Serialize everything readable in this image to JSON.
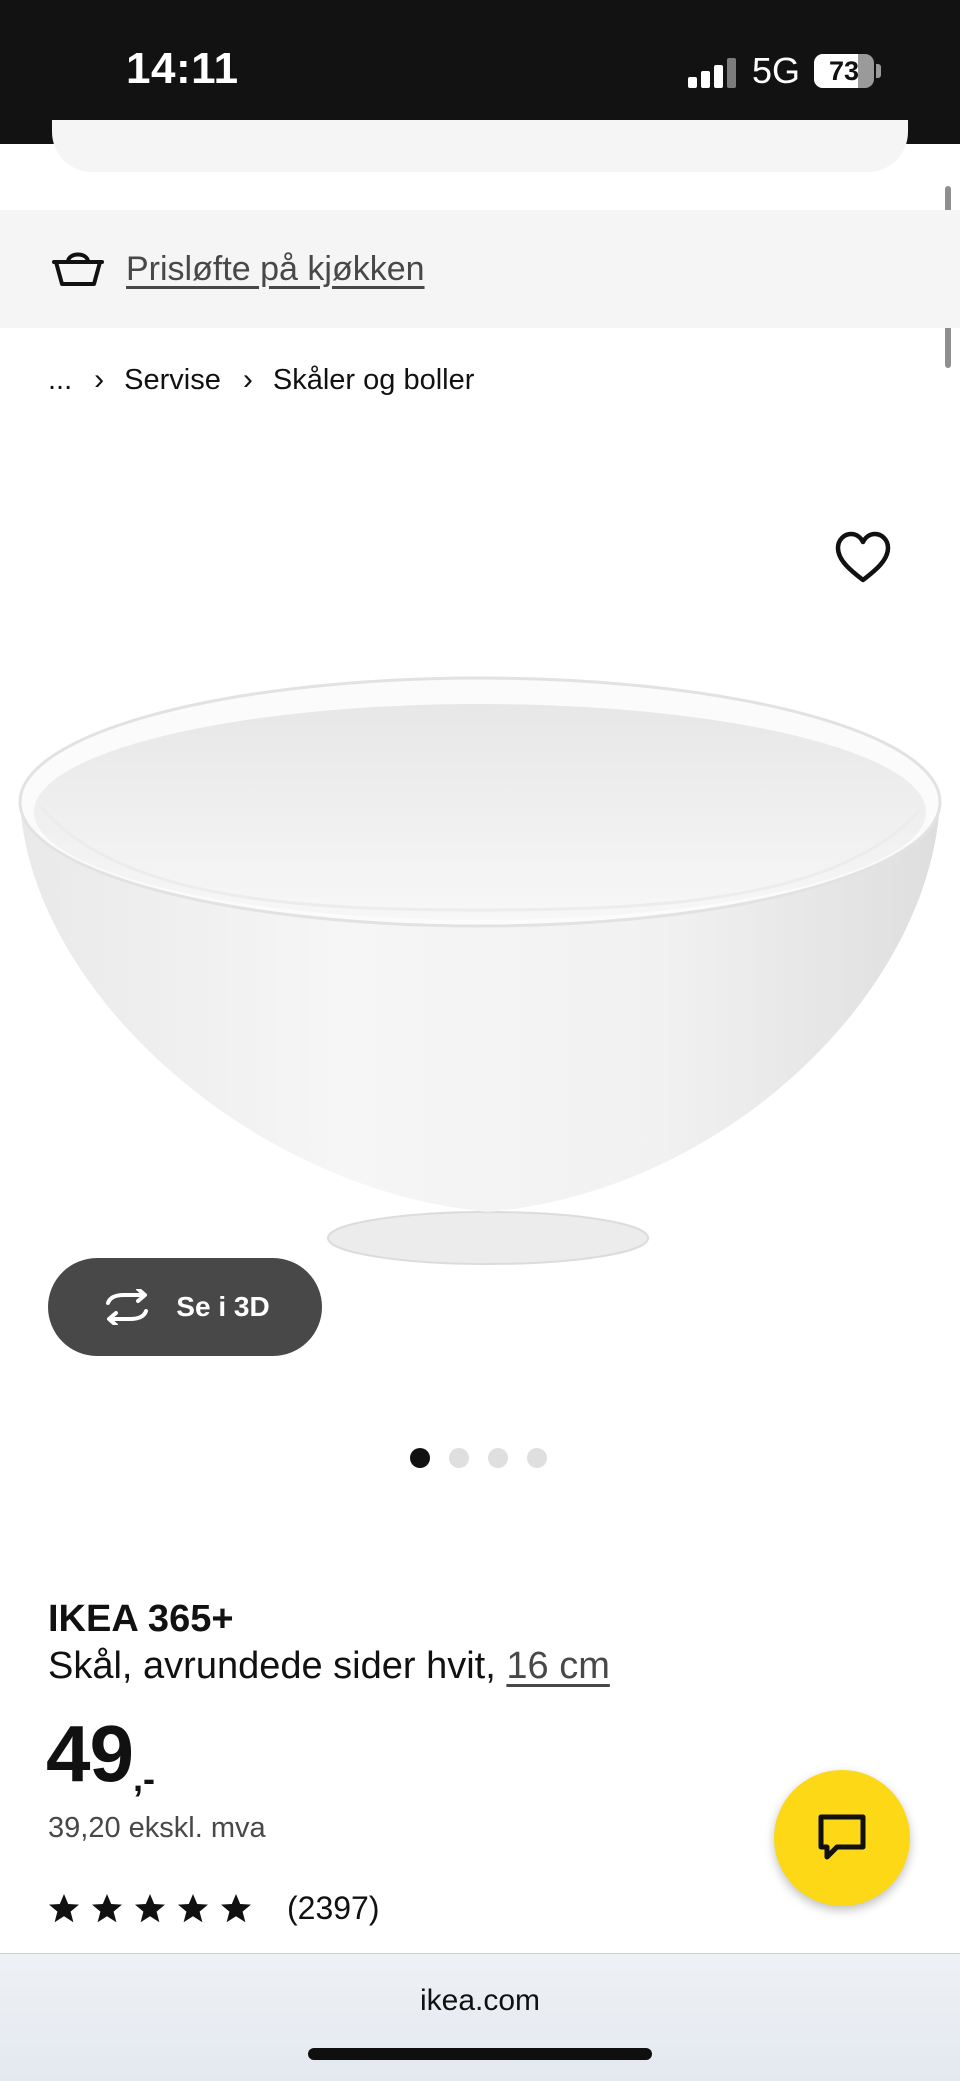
{
  "status_bar": {
    "time": "14:11",
    "network": "5G",
    "battery": "73",
    "battery_level_percent": 73
  },
  "promo": {
    "label": "Prisløfte på kjøkken",
    "icon": "basket-icon"
  },
  "breadcrumb": {
    "ellipsis": "...",
    "items": [
      "Servise",
      "Skåler og boller"
    ]
  },
  "gallery": {
    "view_3d_label": "Se i 3D",
    "total_images": 4,
    "active_index": 0
  },
  "product": {
    "brand": "IKEA 365+",
    "description": "Skål, avrundede sider hvit,",
    "size": "16 cm",
    "price_integer": "49",
    "price_decimal": ",-",
    "price_ex_vat": "39,20 ekskl. mva",
    "rating_stars": 5,
    "rating_count": "(2397)"
  },
  "browser": {
    "url": "ikea.com"
  },
  "colors": {
    "accent_yellow": "#fcd816",
    "button_dark": "#484848",
    "promo_bg": "#f5f5f5"
  }
}
